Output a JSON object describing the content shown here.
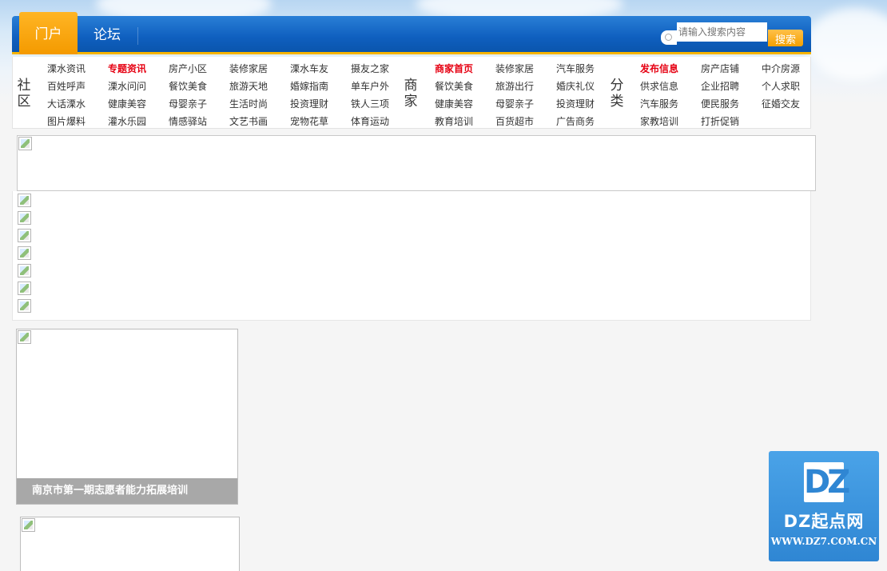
{
  "nav": {
    "tabs": [
      {
        "label": "门户",
        "active": true
      },
      {
        "label": "论坛",
        "active": false
      }
    ],
    "search": {
      "placeholder": "请输入搜索内容",
      "button_label": "搜索"
    }
  },
  "categories": {
    "community": {
      "title": "社区",
      "columns": [
        [
          "溧水资讯",
          "百姓呼声",
          "大话溧水",
          "图片爆料"
        ],
        [
          "专题资讯",
          "溧水问问",
          "健康美容",
          "灌水乐园"
        ],
        [
          "房产小区",
          "餐饮美食",
          "母婴亲子",
          "情感驿站"
        ],
        [
          "装修家居",
          "旅游天地",
          "生活时尚",
          "文艺书画"
        ],
        [
          "溧水车友",
          "婚嫁指南",
          "投资理财",
          "宠物花草"
        ],
        [
          "摄友之家",
          "单车户外",
          "铁人三项",
          "体育运动"
        ]
      ],
      "highlight": [
        "专题资讯"
      ]
    },
    "merchant": {
      "title": "商家",
      "columns": [
        [
          "商家首页",
          "餐饮美食",
          "健康美容",
          "教育培训"
        ],
        [
          "装修家居",
          "旅游出行",
          "母婴亲子",
          "百货超市"
        ],
        [
          "汽车服务",
          "婚庆礼仪",
          "投资理财",
          "广告商务"
        ]
      ],
      "highlight": [
        "商家首页"
      ]
    },
    "classified": {
      "title": "分类",
      "columns": [
        [
          "发布信息",
          "供求信息",
          "汽车服务",
          "家教培训"
        ],
        [
          "房产店铺",
          "企业招聘",
          "便民服务",
          "打折促销"
        ],
        [
          "中介房源",
          "个人求职",
          "征婚交友"
        ]
      ],
      "highlight": [
        "发布信息"
      ]
    }
  },
  "slide": {
    "caption": "南京市第一期志愿者能力拓展培训"
  },
  "watermark": {
    "letters": "DZ",
    "name": "DZ起点网",
    "url": "WWW.DZ7.COM.CN"
  },
  "colors": {
    "nav_blue": "#0f5fbf",
    "nav_orange": "#f49a00",
    "hot_red": "#e60012"
  }
}
